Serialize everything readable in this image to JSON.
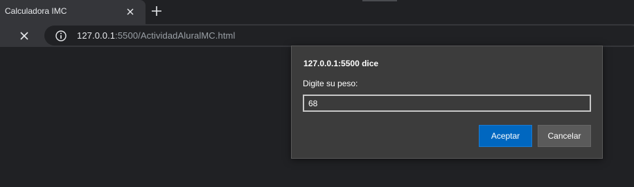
{
  "tab": {
    "title": "Calculadora IMC",
    "close_icon": "close-icon"
  },
  "toolbar": {
    "new_tab_icon": "plus-icon",
    "stop_icon": "stop-loading-icon",
    "info_icon": "info-icon",
    "url_host": "127.0.0.1",
    "url_rest": ":5500/ActividadAluralMC.html"
  },
  "dialog": {
    "title": "127.0.0.1:5500 dice",
    "message": "Digite su peso:",
    "input_value": "68",
    "accept_label": "Aceptar",
    "cancel_label": "Cancelar"
  },
  "colors": {
    "background": "#202124",
    "toolbar": "#35363a",
    "dialog": "#3c3c3c",
    "accent": "#0067c0"
  }
}
